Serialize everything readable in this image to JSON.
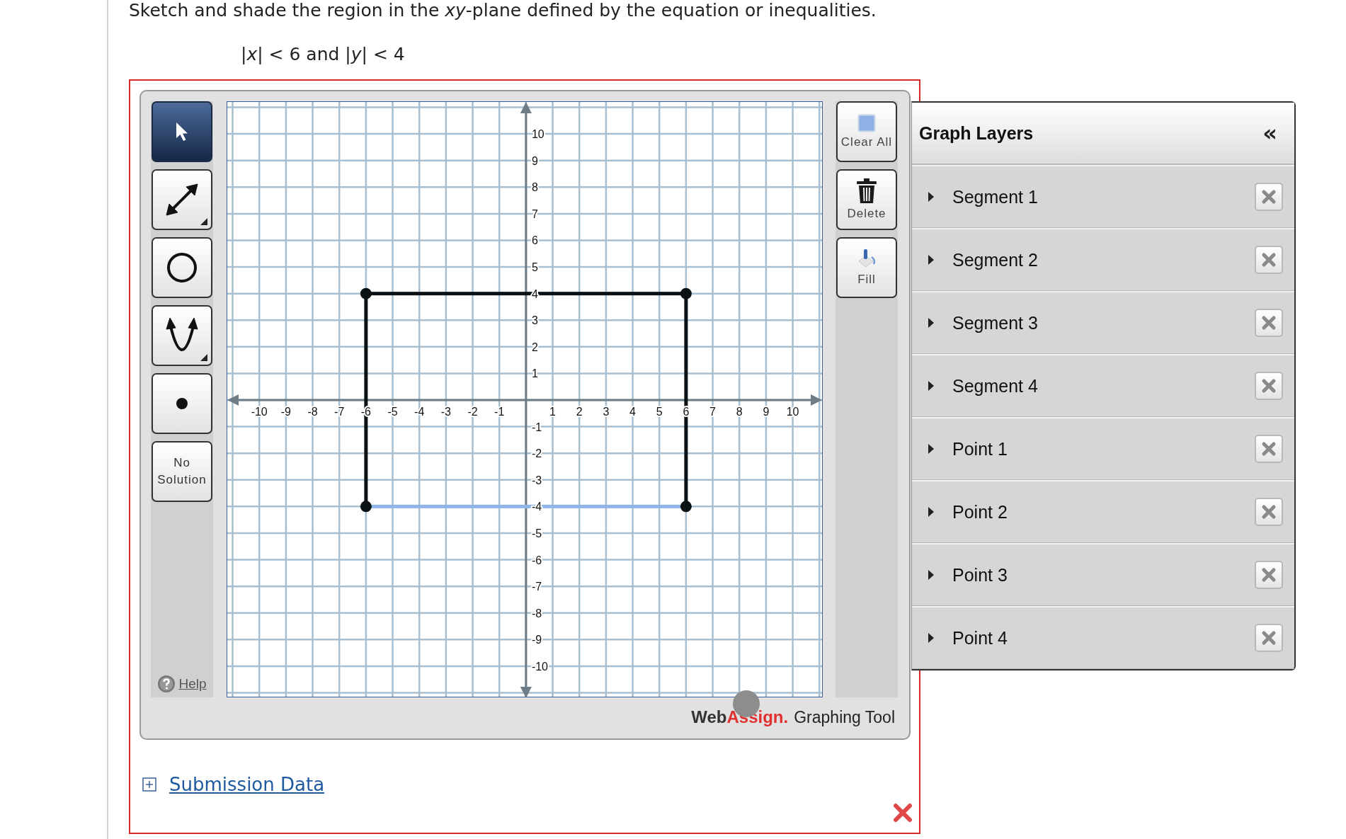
{
  "question": "Sketch and shade the region in the *xy*-plane defined by the equation or inequalities.",
  "formula": "|*x*| < 6 and |*y*| < 4",
  "tools": [
    {
      "kind": "select",
      "selected": true
    },
    {
      "kind": "line",
      "selected": false
    },
    {
      "kind": "circle",
      "selected": false
    },
    {
      "kind": "parabola",
      "selected": false
    },
    {
      "kind": "point",
      "selected": false
    },
    {
      "kind": "text",
      "label": "No Solution",
      "selected": false
    }
  ],
  "help": "Help",
  "actions": [
    {
      "kind": "clear",
      "label": "Clear All"
    },
    {
      "kind": "delete",
      "label": "Delete"
    },
    {
      "kind": "fill",
      "label": "Fill"
    }
  ],
  "graph": {
    "x_tick_labels": [
      "-10",
      "-9",
      "-8",
      "-7",
      "-6",
      "-5",
      "-4",
      "-3",
      "-2",
      "-1",
      "1",
      "2",
      "3",
      "4",
      "5",
      "6",
      "7",
      "8",
      "9",
      "10"
    ],
    "y_tick_labels": [
      "10",
      "9",
      "8",
      "7",
      "6",
      "5",
      "4",
      "3",
      "2",
      "1",
      "-1",
      "-2",
      "-3",
      "-4",
      "-5",
      "-6",
      "-7",
      "-8",
      "-9",
      "-10"
    ],
    "segments": [
      {
        "selected": false
      },
      {
        "selected": false
      },
      {
        "selected": false
      },
      {
        "selected": true
      }
    ]
  },
  "logo": {
    "brand": "Web",
    "brand_accent": "Assign.",
    "product": "Graphing Tool"
  },
  "layers": {
    "title": "Graph Layers",
    "collapse_glyph": "«",
    "items": [
      {
        "label": "Segment 1",
        "expanded": false
      },
      {
        "label": "Segment 2",
        "expanded": false
      },
      {
        "label": "Segment 3",
        "expanded": false
      },
      {
        "label": "Segment 4",
        "expanded": false
      },
      {
        "label": "Point 1",
        "expanded": false
      },
      {
        "label": "Point 2",
        "expanded": false
      },
      {
        "label": "Point 3",
        "expanded": false
      },
      {
        "label": "Point 4",
        "expanded": false
      }
    ]
  },
  "submission_link": "Submission Data",
  "result": {
    "correct": false
  }
}
